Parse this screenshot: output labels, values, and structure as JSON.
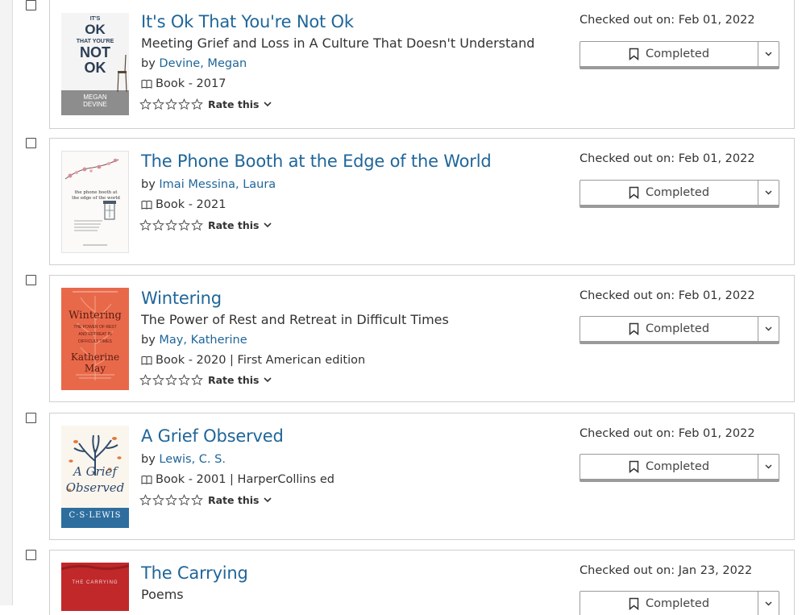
{
  "shelf": {
    "rate_label": "Rate this",
    "status_label": "Completed",
    "items": [
      {
        "title": "It's Ok That You're Not Ok",
        "subtitle": "Meeting Grief and Loss in A Culture That Doesn't Understand",
        "by": "by",
        "author": "Devine, Megan",
        "format": "Book - 2017",
        "checked_out": "Checked out on: Feb 01, 2022",
        "cover": {
          "line1": "IT'S",
          "line2": "OK",
          "line3": "THAT YOU'RE",
          "line4": "NOT",
          "line5": "OK",
          "author": "MEGAN DEVINE"
        }
      },
      {
        "title": "The Phone Booth at the Edge of the World",
        "subtitle": "",
        "by": "by",
        "author": "Imai Messina, Laura",
        "format": "Book - 2021",
        "checked_out": "Checked out on: Feb 01, 2022",
        "cover": {
          "text": "the phone booth at the edge of the world"
        }
      },
      {
        "title": "Wintering",
        "subtitle": "The Power of Rest and Retreat in Difficult Times",
        "by": "by",
        "author": "May, Katherine",
        "format": "Book - 2020 | First American edition",
        "checked_out": "Checked out on: Feb 01, 2022",
        "cover": {
          "title": "Wintering",
          "sub": "THE POWER OF REST AND RETREAT IN DIFFICULT TIMES",
          "author": "Katherine May"
        }
      },
      {
        "title": "A Grief Observed",
        "subtitle": "",
        "by": "by",
        "author": "Lewis, C. S.",
        "format": "Book - 2001 | HarperCollins ed",
        "checked_out": "Checked out on: Feb 01, 2022",
        "cover": {
          "title1": "A Grief",
          "title2": "Observed",
          "author": "C·S·LEWIS"
        }
      },
      {
        "title": "The Carrying",
        "subtitle": "Poems",
        "checked_out": "Checked out on: Jan 23, 2022",
        "cover": {
          "text": "THE CARRYING"
        }
      }
    ]
  },
  "colors": {
    "link": "#1f6699",
    "border": "#cfcfcf",
    "button_border": "#9a9a9a",
    "wintering_cover": "#e8694a",
    "grief_cover_band": "#2d6e9e",
    "carrying_cover": "#c0282a"
  },
  "icons": [
    "checkbox-icon",
    "book-icon",
    "star-icon",
    "chevron-down-icon",
    "bookmark-icon"
  ]
}
